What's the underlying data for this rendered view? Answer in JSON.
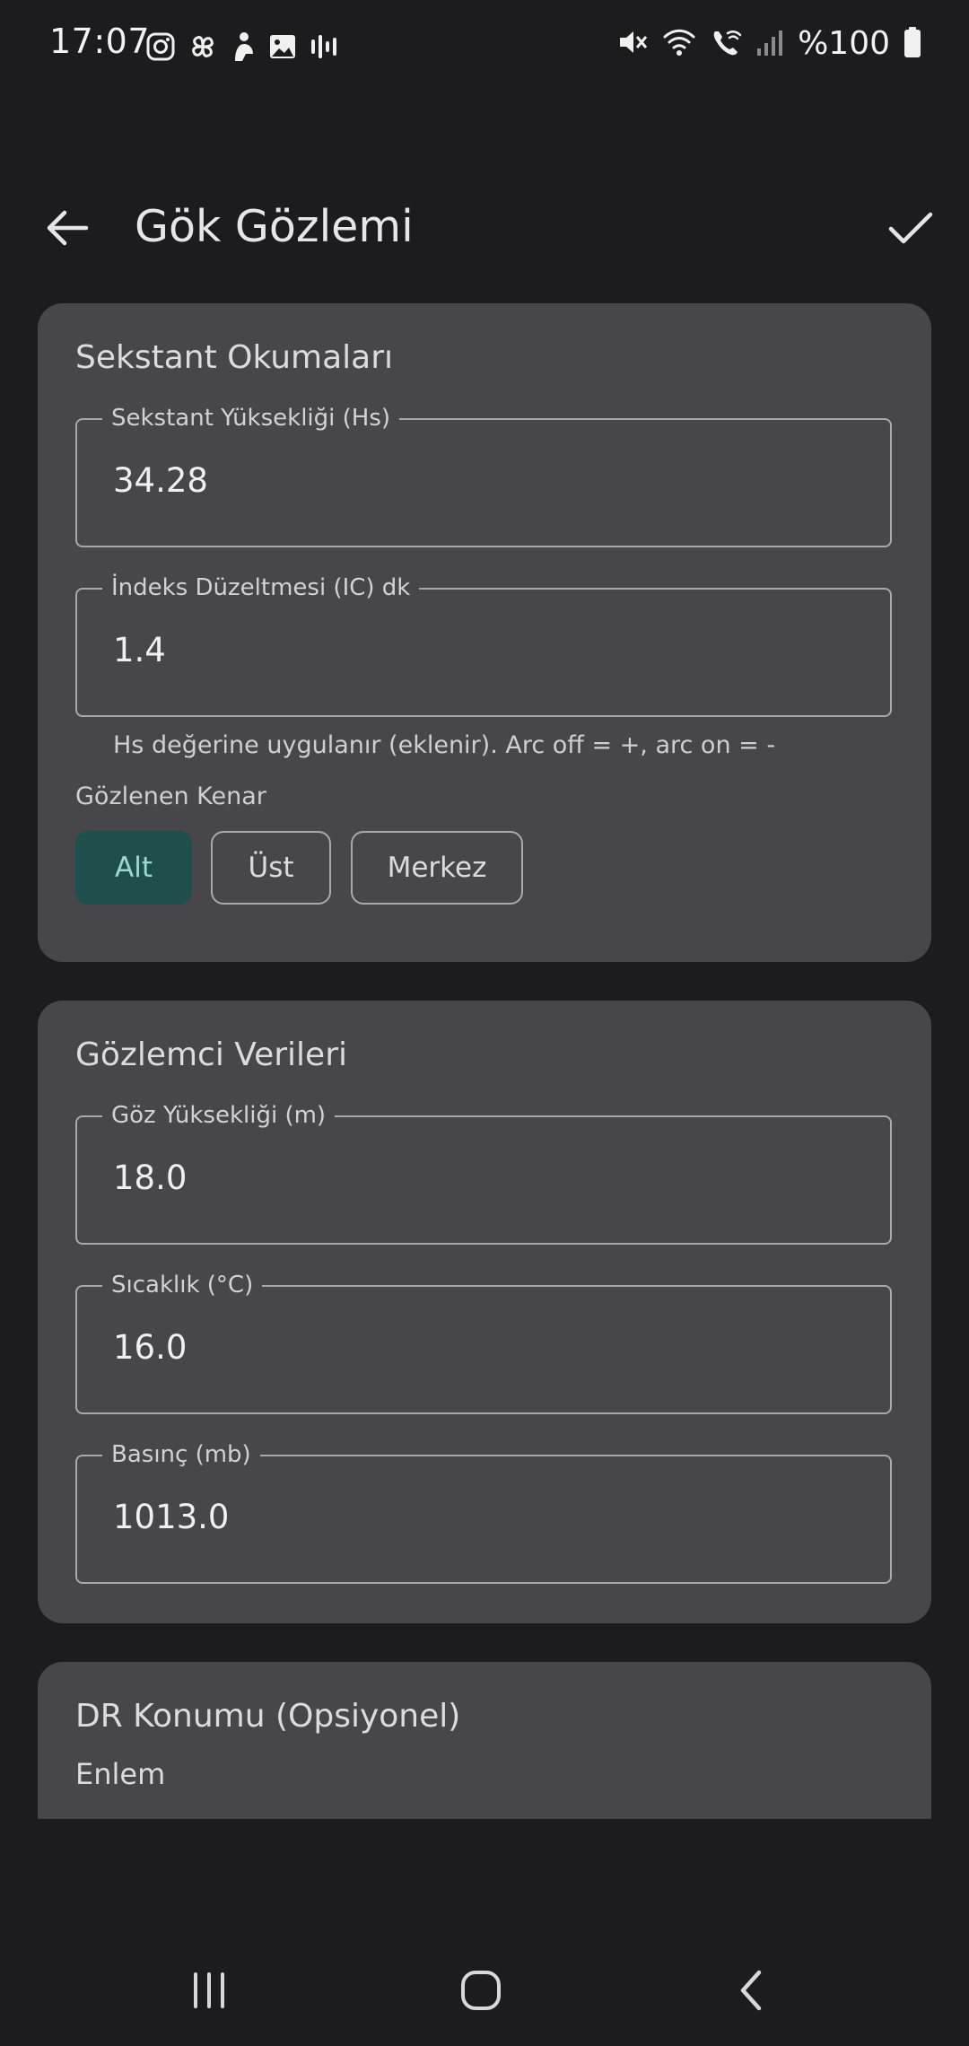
{
  "status_bar": {
    "time": "17:07",
    "battery_text": "%100",
    "left_icons": [
      "instagram-icon",
      "pinwheel-icon",
      "person-icon",
      "image-icon",
      "waveform-icon"
    ],
    "right_icons": [
      "mute-icon",
      "wifi-icon",
      "wifi-call-icon",
      "signal-icon",
      "battery-icon"
    ]
  },
  "app_bar": {
    "title": "Gök Gözlemi",
    "back_icon": "arrow-back-icon",
    "confirm_icon": "check-icon"
  },
  "sextant_card": {
    "title": "Sekstant Okumaları",
    "hs_label": "Sekstant Yüksekliği (Hs)",
    "hs_value": "34.28",
    "ic_label": "İndeks Düzeltmesi (IC) dk",
    "ic_value": "1.4",
    "ic_helper": "Hs değerine uygulanır (eklenir). Arc off = +, arc on = -",
    "limb_label": "Gözlenen Kenar",
    "limb_options": [
      {
        "label": "Alt",
        "selected": true
      },
      {
        "label": "Üst",
        "selected": false
      },
      {
        "label": "Merkez",
        "selected": false
      }
    ]
  },
  "observer_card": {
    "title": "Gözlemci Verileri",
    "eye_label": "Göz Yüksekliği (m)",
    "eye_value": "18.0",
    "temp_label": "Sıcaklık (°C)",
    "temp_value": "16.0",
    "pressure_label": "Basınç (mb)",
    "pressure_value": "1013.0"
  },
  "dr_card": {
    "title": "DR Konumu (Opsiyonel)",
    "lat_label": "Enlem"
  },
  "colors": {
    "background": "#1c1c1e",
    "card": "#47474b",
    "selected_chip_bg": "#1f4f4c",
    "selected_chip_text": "#9ad9d1"
  }
}
